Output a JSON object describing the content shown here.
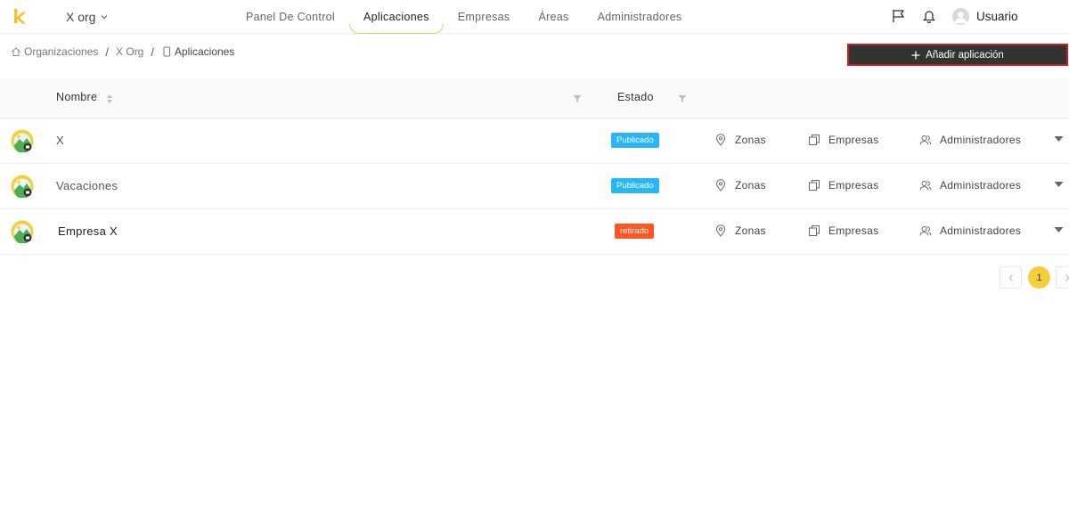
{
  "header": {
    "org_name": "X org",
    "tabs": [
      {
        "label": "Panel De Control",
        "active": false
      },
      {
        "label": "Aplicaciones",
        "active": true
      },
      {
        "label": "Empresas",
        "active": false
      },
      {
        "label": "Áreas",
        "active": false
      },
      {
        "label": "Administradores",
        "active": false
      }
    ],
    "user_name": "Usuario",
    "icons": {
      "flag": "flag-icon",
      "bell": "bell-icon",
      "avatar": "user-avatar-icon"
    }
  },
  "breadcrumb": {
    "items": [
      "Organizaciones",
      "X Org",
      "Aplicaciones"
    ],
    "separator": "/"
  },
  "actions": {
    "add_app_label": "Añadir aplicación"
  },
  "table": {
    "columns": {
      "name": "Nombre",
      "status": "Estado"
    },
    "rows": [
      {
        "name": "X",
        "status": "Publicado",
        "status_type": "published",
        "zones": "Zonas",
        "companies": "Empresas",
        "admins": "Administradores"
      },
      {
        "name": "Vacaciones",
        "status": "Publicado",
        "status_type": "published",
        "zones": "Zonas",
        "companies": "Empresas",
        "admins": "Administradores"
      },
      {
        "name": "Empresa X",
        "status": "retirado",
        "status_type": "retired",
        "zones": "Zonas",
        "companies": "Empresas",
        "admins": "Administradores"
      }
    ]
  },
  "pagination": {
    "current_page": "1"
  },
  "colors": {
    "accent": "#f5cf3b",
    "published": "#29b6f6",
    "retired": "#ff5722",
    "button_bg": "#333333"
  }
}
